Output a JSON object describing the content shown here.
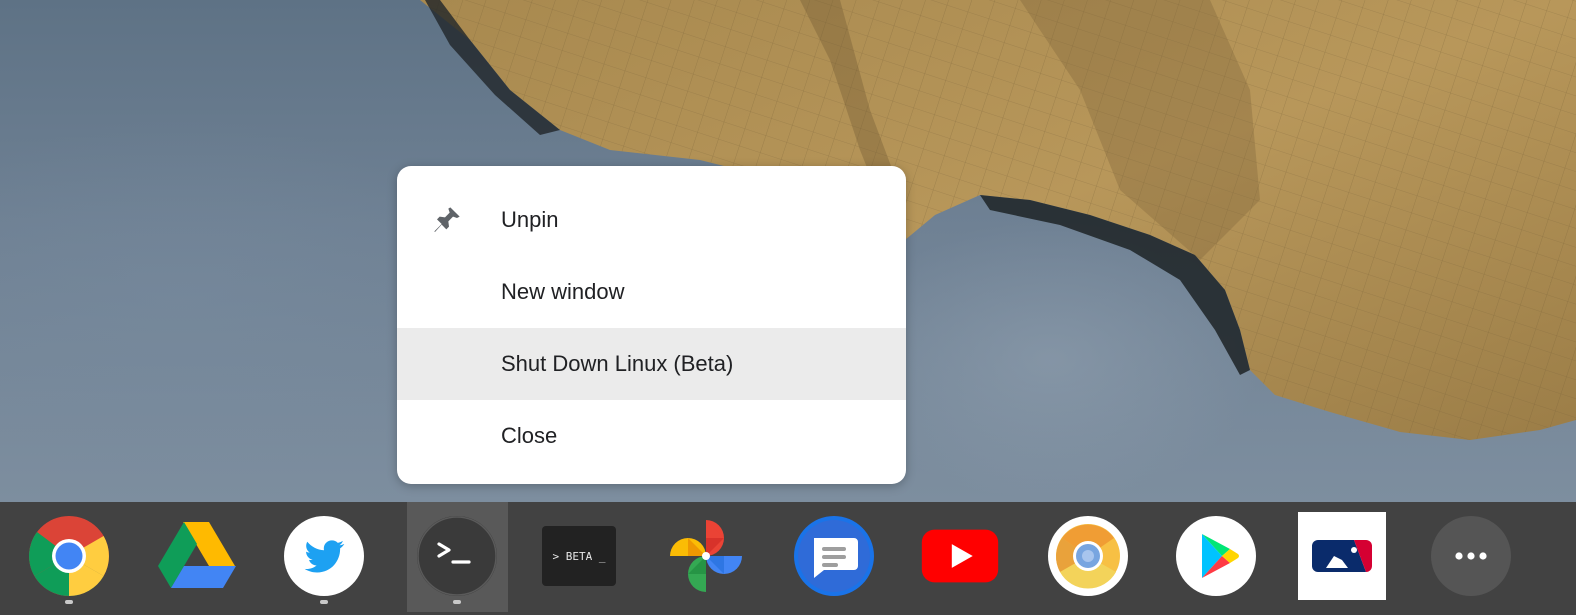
{
  "context_menu": {
    "items": [
      {
        "label": "Unpin",
        "icon": "pin-icon",
        "highlighted": false
      },
      {
        "label": "New window",
        "icon": "",
        "highlighted": false
      },
      {
        "label": "Shut Down Linux (Beta)",
        "icon": "",
        "highlighted": true
      },
      {
        "label": "Close",
        "icon": "",
        "highlighted": false
      }
    ]
  },
  "shelf": {
    "apps": [
      {
        "name": "Chrome",
        "icon": "chrome-icon",
        "running": true
      },
      {
        "name": "Google Drive",
        "icon": "google-drive-icon",
        "running": false
      },
      {
        "name": "Twitter",
        "icon": "twitter-icon",
        "running": true
      },
      {
        "name": "Terminal",
        "icon": "terminal-icon",
        "running": true,
        "active": true
      },
      {
        "name": "Linux (Beta)",
        "icon": "linux-beta-icon",
        "running": false,
        "glyph_text": "> BETA _"
      },
      {
        "name": "Google Photos",
        "icon": "google-photos-icon",
        "running": false
      },
      {
        "name": "Messages",
        "icon": "messages-icon",
        "running": false
      },
      {
        "name": "YouTube",
        "icon": "youtube-icon",
        "running": false
      },
      {
        "name": "Chrome Canary",
        "icon": "chrome-canary-icon",
        "running": false
      },
      {
        "name": "Google Play Store",
        "icon": "play-store-icon",
        "running": false
      },
      {
        "name": "MLB",
        "icon": "mlb-icon",
        "running": false
      },
      {
        "name": "More apps",
        "icon": "more-icon",
        "running": false
      }
    ]
  },
  "colors": {
    "menu_bg": "#ffffff",
    "menu_highlight": "#ebebeb",
    "shelf_bg": "#3a3a3a",
    "text": "#202124"
  }
}
